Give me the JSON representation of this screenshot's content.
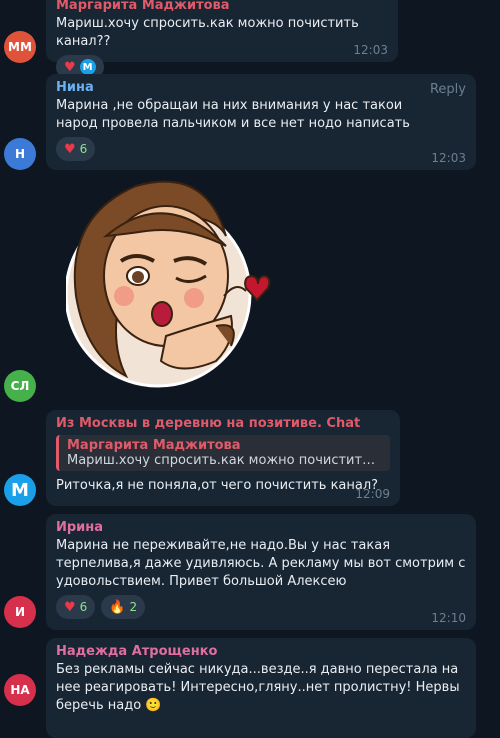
{
  "messages": [
    {
      "avatar": "ММ",
      "avatar_color": "#e0533b",
      "sender": "Маргарита Маджитова",
      "sender_color": "#e05a6a",
      "text": "Мариш.хочу спросить.как можно почистить канал??",
      "time": "12:03",
      "reactions": [
        {
          "icon": "heart-icon"
        },
        {
          "icon": "avatar-m-icon"
        }
      ]
    },
    {
      "avatar": "Н",
      "avatar_color": "#3b7ad6",
      "sender": "Нина",
      "sender_color": "#6ab0f3",
      "reply_label": "Reply",
      "text": "Марина ,не обращаи на них внимания у нас такои народ провела пальчиком и все нет нодо написать",
      "time": "12:03",
      "reactions": [
        {
          "icon": "heart-icon",
          "count": "6"
        }
      ]
    },
    {
      "avatar": "СЛ",
      "avatar_color": "#46b04a",
      "sticker": "winking-woman-kiss-sticker"
    },
    {
      "avatar": "М",
      "avatar_color": "#1aa0e8",
      "sender": "Из Москвы в деревню на позитиве. Chat",
      "sender_color": "#e05a6a",
      "quote_name": "Маргарита Маджитова",
      "quote_text": "Мариш.хочу спросить.как можно почистить кан...",
      "text": "Риточка,я не поняла,от чего почистить канал?",
      "time": "12:09"
    },
    {
      "avatar": "И",
      "avatar_color": "#d6304d",
      "sender": "Ирина",
      "sender_color": "#e06fa0",
      "text": "Марина не переживайте,не надо.Вы у нас такая терпелива,я даже удивляюсь. А рекламу мы вот смотрим с удовольствием. Привет большой Алексею",
      "time": "12:10",
      "reactions": [
        {
          "icon": "heart-icon",
          "count": "6"
        },
        {
          "icon": "fire-icon",
          "count": "2"
        }
      ]
    },
    {
      "avatar": "НА",
      "avatar_color": "#d6304d",
      "sender": "Надежда Атрощенко",
      "sender_color": "#e06fa0",
      "text": "Без рекламы сейчас никуда...везде..я давно перестала на нее реагировать! Интересно,гляну..нет пролистну! Нервы беречь надо",
      "emoji": "🙂"
    }
  ]
}
